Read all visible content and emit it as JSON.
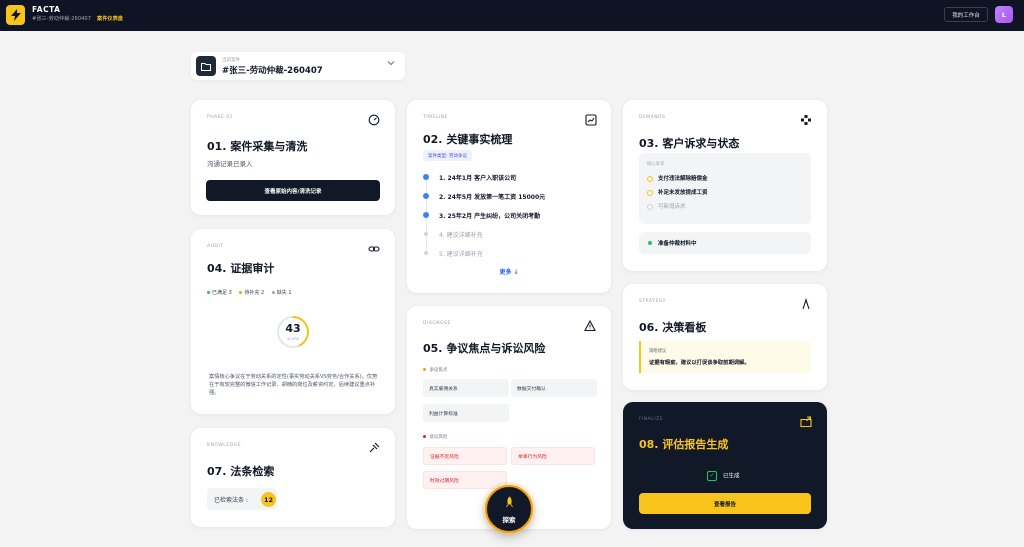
{
  "app": {
    "name": "FACTA",
    "case_code": "#张三-劳动仲裁-260407",
    "mode": "案件仪表盘"
  },
  "header": {
    "workspace_btn": "我的工作台",
    "avatar_letter": "L"
  },
  "case_selector": {
    "label": "当前案件",
    "value": "#张三-劳动仲裁-260407"
  },
  "cards": {
    "intake": {
      "tag": "PHASE 01",
      "title": "01. 案件采集与清洗",
      "subtitle": "沟通记录已录入",
      "button": "查看原始内容/清洗记录"
    },
    "audit": {
      "tag": "AUDIT",
      "title": "04. 证据审计",
      "legend": [
        {
          "label": "已满足 3",
          "color": "#22c55e"
        },
        {
          "label": "待补充 2",
          "color": "#f59e0b"
        },
        {
          "label": "缺失 1",
          "color": "#9ca3af"
        }
      ],
      "score": "43",
      "score_unit": "SCORE",
      "score_progress": 0.43,
      "text": "案情核心争议在于劳动关系的定性(事实劳动关系VS劳务/合作关系)。优势在于有较完整的微信工作记录、胡楠的岗位及薪资约定。后续建议重点补强。"
    },
    "knowledge": {
      "tag": "KNOWLEDGE",
      "title": "07. 法条检索",
      "count_label": "已检索法条 :",
      "count": "12"
    },
    "timeline": {
      "tag": "TIMELINE",
      "title": "02. 关键事实梳理",
      "pill": "案件类型: 劳动争议",
      "items": [
        {
          "text": "1. 24年1月 客户入职该公司",
          "active": true
        },
        {
          "text": "2. 24年5月 发放第一笔工资 15000元",
          "active": true
        },
        {
          "text": "3. 25年2月 产生纠纷，公司关闭考勤",
          "active": true
        },
        {
          "text": "4. 建议详细补充",
          "active": false
        },
        {
          "text": "5. 建议详细补充",
          "active": false
        }
      ],
      "more": "更多 ↓"
    },
    "diagnose": {
      "tag": "DIAGNOSE",
      "title": "05. 争议焦点与诉讼风险",
      "focus_label": "争议焦点",
      "focus_color": "#f59e0b",
      "focus_items": [
        "真实雇佣关系",
        "数据交付确认",
        "利益计算标准"
      ],
      "risk_label": "诉讼风险",
      "risk_color": "#dc2626",
      "risk_items": [
        "证据不足风险",
        "举事行为风险",
        "时效过期风险"
      ]
    },
    "demands": {
      "tag": "DEMANDS",
      "title": "03. 客户诉求与状态",
      "box_label": "核心诉求",
      "items": [
        {
          "text": "支付违法解除赔偿金",
          "active": true
        },
        {
          "text": "补足未发放提成工资",
          "active": true
        },
        {
          "text": "可新增诉求",
          "active": false
        }
      ],
      "status": "准备仲裁材料中"
    },
    "strategy": {
      "tag": "STRATEGY",
      "title": "06. 决策看板",
      "box_label": "策略建议",
      "box_text": "证据有瑕疵，建议以打促谈争取前期调解。"
    },
    "finalize": {
      "tag": "FINALIZE",
      "title": "08. 评估报告生成",
      "done_label": "已生成",
      "button": "查看报告"
    }
  },
  "explore_button": {
    "label": "探索"
  },
  "colors": {
    "accent": "#f8c41c",
    "navy": "#0f1424",
    "blue": "#3b82f6",
    "green": "#22c55e",
    "red": "#dc2626"
  },
  "icons": [
    "bolt-icon",
    "folder-icon",
    "chevron-down-icon",
    "gauge-icon",
    "chart-icon",
    "network-icon",
    "link-icon",
    "warning-icon",
    "compass-icon",
    "gavel-icon",
    "export-icon",
    "rocket-icon"
  ]
}
